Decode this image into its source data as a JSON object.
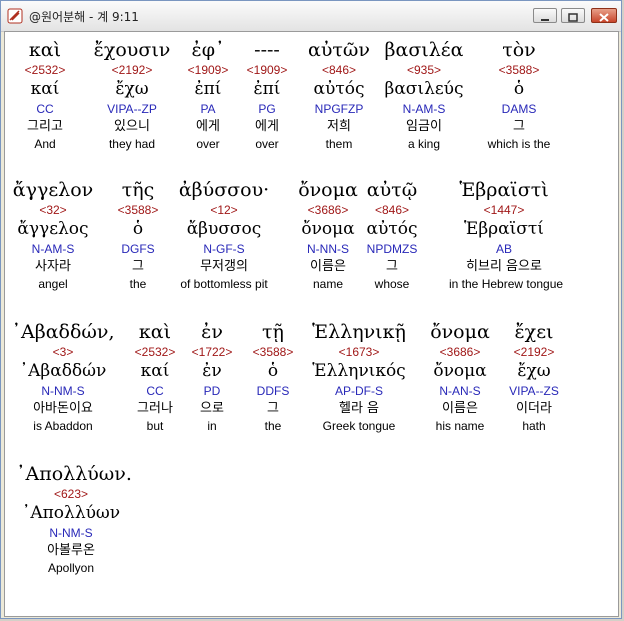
{
  "window": {
    "title": "@원어분해 - 계 9:11"
  },
  "colors": {
    "strong": "#a01818",
    "morph": "#2828b8"
  },
  "rows": [
    [
      {
        "greek": "καὶ",
        "strong": "<2532>",
        "lemma": "καί",
        "morph": "CC",
        "korean": "그리고",
        "english": "And"
      },
      {
        "greek": "ἔχουσιν",
        "strong": "<2192>",
        "lemma": "ἔχω",
        "morph": "VIPA--ZP",
        "korean": "있으니",
        "english": "they had"
      },
      {
        "greek": "ἐφ᾽",
        "strong": "<1909>",
        "lemma": "ἐπί",
        "morph": "PA",
        "korean": "에게",
        "english": "over"
      },
      {
        "greek": "----",
        "strong": "<1909>",
        "lemma": "ἐπί",
        "morph": "PG",
        "korean": "에게",
        "english": "over"
      },
      {
        "greek": "αὐτῶν",
        "strong": "<846>",
        "lemma": "αὐτός",
        "morph": "NPGFZP",
        "korean": "저희",
        "english": "them"
      },
      {
        "greek": "βασιλέα",
        "strong": "<935>",
        "lemma": "βασιλεύς",
        "morph": "N-AM-S",
        "korean": "임금이",
        "english": "a king"
      },
      {
        "greek": "τὸν",
        "strong": "<3588>",
        "lemma": "ὁ",
        "morph": "DAMS",
        "korean": "그",
        "english": "which is the"
      }
    ],
    [
      {
        "greek": "ἄγγελον",
        "strong": "<32>",
        "lemma": "ἄγγελος",
        "morph": "N-AM-S",
        "korean": "사자라",
        "english": "angel"
      },
      {
        "greek": "τῆς",
        "strong": "<3588>",
        "lemma": "ὁ",
        "morph": "DGFS",
        "korean": "그",
        "english": "the"
      },
      {
        "greek": "ἀβύσσου·",
        "strong": "<12>",
        "lemma": "ἄβυσσος",
        "morph": "N-GF-S",
        "korean": "무저갱의",
        "english": "of bottomless pit"
      },
      {
        "greek": "ὄνομα",
        "strong": "<3686>",
        "lemma": "ὄνομα",
        "morph": "N-NN-S",
        "korean": "이름은",
        "english": "name"
      },
      {
        "greek": "αὐτῷ",
        "strong": "<846>",
        "lemma": "αὐτός",
        "morph": "NPDMZS",
        "korean": "그",
        "english": "whose"
      },
      {
        "greek": "Ἑβραϊστὶ",
        "strong": "<1447>",
        "lemma": "Ἑβραϊστί",
        "morph": "AB",
        "korean": "히브리 음으로",
        "english": "in the Hebrew tongue"
      }
    ],
    [
      {
        "greek": "᾿Αβαδδών,",
        "strong": "<3>",
        "lemma": "᾿Αβαδδών",
        "morph": "N-NM-S",
        "korean": "아바돈이요",
        "english": "is Abaddon"
      },
      {
        "greek": "καὶ",
        "strong": "<2532>",
        "lemma": "καί",
        "morph": "CC",
        "korean": "그러나",
        "english": "but"
      },
      {
        "greek": "ἐν",
        "strong": "<1722>",
        "lemma": "ἐν",
        "morph": "PD",
        "korean": "으로",
        "english": "in"
      },
      {
        "greek": "τῇ",
        "strong": "<3588>",
        "lemma": "ὁ",
        "morph": "DDFS",
        "korean": "그",
        "english": "the"
      },
      {
        "greek": "Ἑλληνικῇ",
        "strong": "<1673>",
        "lemma": "Ἑλληνικός",
        "morph": "AP-DF-S",
        "korean": "헬라 음",
        "english": "Greek tongue"
      },
      {
        "greek": "ὄνομα",
        "strong": "<3686>",
        "lemma": "ὄνομα",
        "morph": "N-AN-S",
        "korean": "이름은",
        "english": "his name"
      },
      {
        "greek": "ἔχει",
        "strong": "<2192>",
        "lemma": "ἔχω",
        "morph": "VIPA--ZS",
        "korean": "이더라",
        "english": "hath"
      }
    ],
    [
      {
        "greek": "᾿Απολλύων.",
        "strong": "<623>",
        "lemma": "᾿Απολλύων",
        "morph": "N-NM-S",
        "korean": "아볼루온",
        "english": "Apollyon"
      }
    ]
  ]
}
